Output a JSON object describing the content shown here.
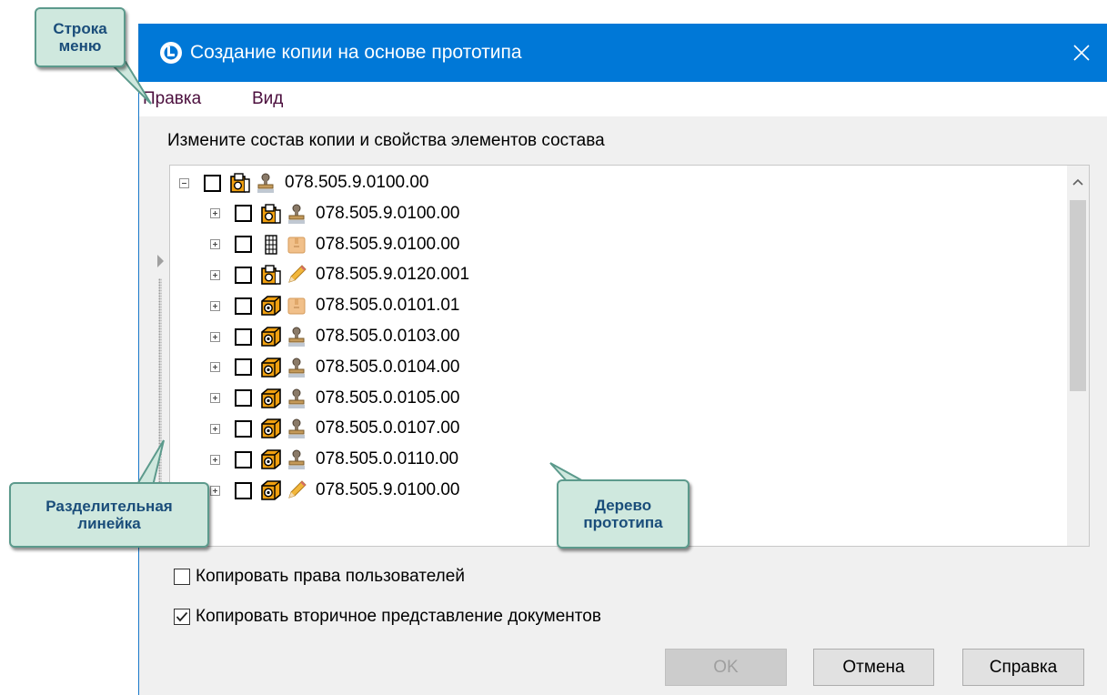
{
  "window": {
    "title": "Создание копии на основе прототипа"
  },
  "menu": [
    {
      "label": "Правка"
    },
    {
      "label": "Вид"
    }
  ],
  "instruction": "Измените состав копии и свойства элементов состава",
  "tree": {
    "root": {
      "label": "078.505.9.0100.00",
      "type_icon": "assembly-icon",
      "status_icon": "stamp-icon",
      "expanded": true,
      "checked": false
    },
    "children": [
      {
        "label": "078.505.9.0100.00",
        "type_icon": "assembly-icon",
        "status_icon": "stamp-icon",
        "checked": false
      },
      {
        "label": "078.505.9.0100.00",
        "type_icon": "document-grid-icon",
        "status_icon": "package-icon",
        "checked": false
      },
      {
        "label": "078.505.9.0120.001",
        "type_icon": "assembly-icon",
        "status_icon": "pencil-icon",
        "checked": false
      },
      {
        "label": "078.505.0.0101.01",
        "type_icon": "part-icon",
        "status_icon": "package-icon",
        "checked": false
      },
      {
        "label": "078.505.0.0103.00",
        "type_icon": "part-icon",
        "status_icon": "stamp-icon",
        "checked": false
      },
      {
        "label": "078.505.0.0104.00",
        "type_icon": "part-icon",
        "status_icon": "stamp-icon",
        "checked": false
      },
      {
        "label": "078.505.0.0105.00",
        "type_icon": "part-icon",
        "status_icon": "stamp-icon",
        "checked": false
      },
      {
        "label": "078.505.0.0107.00",
        "type_icon": "part-icon",
        "status_icon": "stamp-icon",
        "checked": false
      },
      {
        "label": "078.505.0.0110.00",
        "type_icon": "part-icon",
        "status_icon": "stamp-icon",
        "checked": false
      },
      {
        "label": "078.505.9.0100.00",
        "type_icon": "part-icon",
        "status_icon": "pencil-icon",
        "checked": false
      }
    ]
  },
  "options": {
    "copy_rights": {
      "label": "Копировать права пользователей",
      "checked": false
    },
    "copy_secondary": {
      "label": "Копировать вторичное представление документов",
      "checked": true
    }
  },
  "buttons": {
    "ok": "OK",
    "cancel": "Отмена",
    "help": "Справка"
  },
  "callouts": {
    "menu_bar": "Строка\nменю",
    "splitter": "Разделительная\nлинейка",
    "tree": "Дерево\nпрототипа"
  },
  "colors": {
    "titlebar": "#0078d7",
    "menu_text": "#4b0e3d",
    "callout_fill": "#cfe8de",
    "callout_border": "#5c9a8c",
    "callout_text": "#1a4d7a",
    "icon_orange": "#f0a010"
  }
}
